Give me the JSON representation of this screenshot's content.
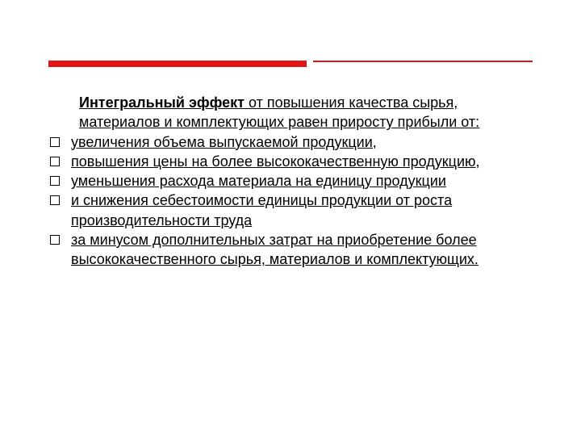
{
  "intro": {
    "bold": "Интегральный эффект",
    "rest1": " от повышения качества сырья, материалов и комплектующих равен приросту прибыли от:"
  },
  "bullets": [
    {
      "text": " увеличения объема выпускаемой продукции,"
    },
    {
      "text": " повышения цены на более высококачественную продукцию,"
    },
    {
      "text": " уменьшения расхода материала на единицу продукции"
    },
    {
      "text": " и снижения себестоимости единицы продукции от роста производительности труда"
    },
    {
      "text": " за минусом дополнительных затрат на приобретение более высококачественного сырья, материалов и комплектующих."
    }
  ],
  "colors": {
    "accent": "#e11515"
  }
}
